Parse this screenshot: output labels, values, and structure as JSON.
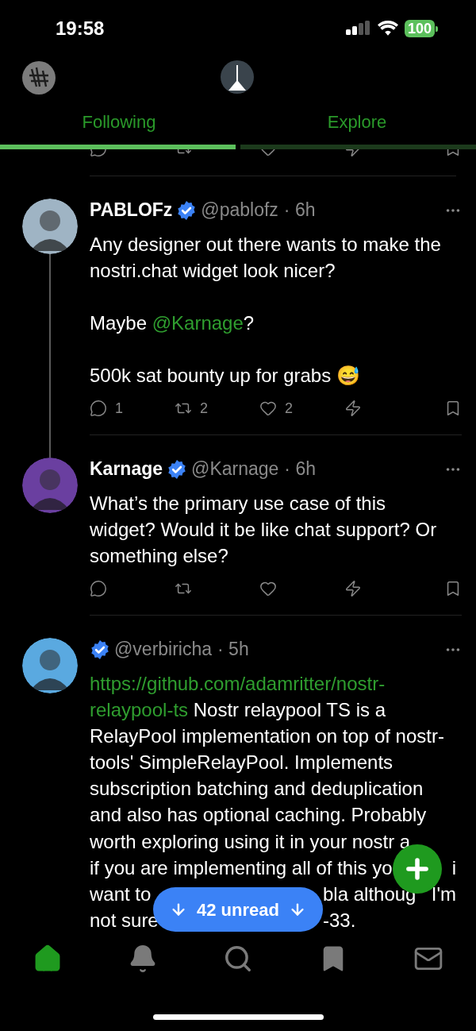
{
  "status_bar": {
    "time": "19:58",
    "battery": "100"
  },
  "tabs": [
    {
      "label": "Following",
      "selected": true
    },
    {
      "label": "Explore",
      "selected": false
    }
  ],
  "previous_note_actions": [
    {
      "kind": "reply"
    },
    {
      "kind": "repost"
    },
    {
      "kind": "like"
    },
    {
      "kind": "zap"
    },
    {
      "kind": "bookmark"
    }
  ],
  "notes": [
    {
      "name": "PABLOFz",
      "verified": true,
      "handle": "@pablofz",
      "time": "· 6h",
      "thread_line": true,
      "paragraphs": [
        [
          {
            "kind": "text",
            "text": "Any designer out there wants to make the nostri.chat widget look nicer?"
          }
        ],
        [
          {
            "kind": "text",
            "text": "Maybe "
          },
          {
            "kind": "link",
            "text": "@Karnage"
          },
          {
            "kind": "text",
            "text": "?"
          }
        ],
        [
          {
            "kind": "text",
            "text": "500k sat bounty up for grabs 😅"
          }
        ]
      ],
      "actions": [
        {
          "kind": "reply",
          "count": "1"
        },
        {
          "kind": "repost",
          "count": "2"
        },
        {
          "kind": "like",
          "count": "2"
        },
        {
          "kind": "zap"
        },
        {
          "kind": "bookmark"
        }
      ]
    },
    {
      "name": "Karnage",
      "verified": true,
      "handle": "@Karnage",
      "time": "· 6h",
      "thread_line": false,
      "paragraphs": [
        [
          {
            "kind": "text",
            "text": "What’s the primary use case of this widget? Would it be like chat support? Or something else?"
          }
        ]
      ],
      "actions": [
        {
          "kind": "reply"
        },
        {
          "kind": "repost"
        },
        {
          "kind": "like"
        },
        {
          "kind": "zap"
        },
        {
          "kind": "bookmark"
        }
      ]
    },
    {
      "verified": true,
      "handle": "@verbiricha",
      "time": "· 5h",
      "thread_line": false,
      "paragraphs": [
        [
          {
            "kind": "link",
            "text": "https://github.com/adamritter/nostr-"
          },
          {
            "kind": "break"
          },
          {
            "kind": "link",
            "text": "relaypool-ts"
          },
          {
            "kind": "text",
            "text": " Nostr relaypool TS is a RelayPool implementation on top of nostr-tools' SimpleRelayPool. Implements subscription batching and deduplication and also has optional caching. Probably"
          }
        ]
      ],
      "lines": [
        [
          {
            "kind": "text",
            "text": "worth exploring using it in your nostr a"
          },
          {
            "kind": "gap_fab"
          }
        ],
        [
          {
            "kind": "text",
            "text": "if you are implementing all of this yo"
          },
          {
            "kind": "gap_fab"
          },
          {
            "kind": "text",
            "text": "i"
          }
        ],
        [
          {
            "kind": "text",
            "text": "want to"
          },
          {
            "kind": "gap_pill"
          },
          {
            "kind": "text",
            "text": "bla althoug"
          },
          {
            "kind": "gap_fab"
          },
          {
            "kind": "text",
            "text": "I'm"
          }
        ],
        [
          {
            "kind": "text",
            "text": "not sure"
          },
          {
            "kind": "gap_pill"
          },
          {
            "kind": "text",
            "text": "-33."
          }
        ]
      ]
    }
  ],
  "unread_pill": {
    "label": "42 unread"
  },
  "nav": [
    {
      "kind": "home",
      "selected": true
    },
    {
      "kind": "notifications",
      "selected": false
    },
    {
      "kind": "search",
      "selected": false
    },
    {
      "kind": "bookmarks",
      "selected": false
    },
    {
      "kind": "messages",
      "selected": false
    }
  ]
}
